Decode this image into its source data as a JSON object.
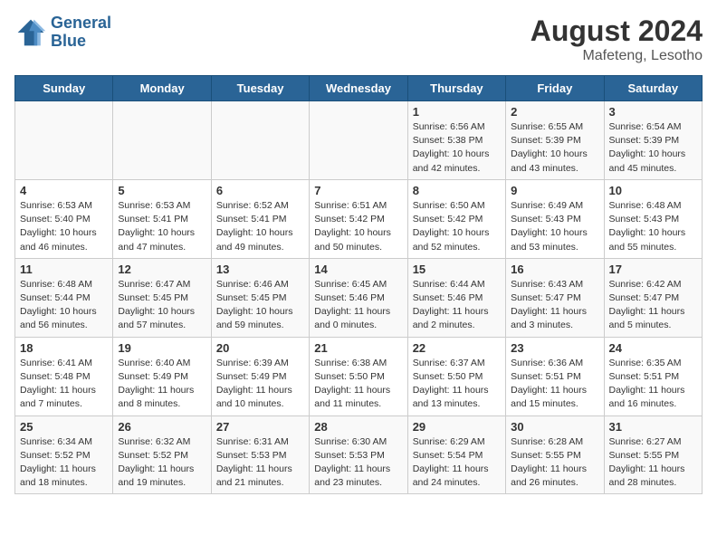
{
  "header": {
    "logo_line1": "General",
    "logo_line2": "Blue",
    "month_year": "August 2024",
    "location": "Mafeteng, Lesotho"
  },
  "weekdays": [
    "Sunday",
    "Monday",
    "Tuesday",
    "Wednesday",
    "Thursday",
    "Friday",
    "Saturday"
  ],
  "weeks": [
    [
      {
        "day": "",
        "info": ""
      },
      {
        "day": "",
        "info": ""
      },
      {
        "day": "",
        "info": ""
      },
      {
        "day": "",
        "info": ""
      },
      {
        "day": "1",
        "info": "Sunrise: 6:56 AM\nSunset: 5:38 PM\nDaylight: 10 hours\nand 42 minutes."
      },
      {
        "day": "2",
        "info": "Sunrise: 6:55 AM\nSunset: 5:39 PM\nDaylight: 10 hours\nand 43 minutes."
      },
      {
        "day": "3",
        "info": "Sunrise: 6:54 AM\nSunset: 5:39 PM\nDaylight: 10 hours\nand 45 minutes."
      }
    ],
    [
      {
        "day": "4",
        "info": "Sunrise: 6:53 AM\nSunset: 5:40 PM\nDaylight: 10 hours\nand 46 minutes."
      },
      {
        "day": "5",
        "info": "Sunrise: 6:53 AM\nSunset: 5:41 PM\nDaylight: 10 hours\nand 47 minutes."
      },
      {
        "day": "6",
        "info": "Sunrise: 6:52 AM\nSunset: 5:41 PM\nDaylight: 10 hours\nand 49 minutes."
      },
      {
        "day": "7",
        "info": "Sunrise: 6:51 AM\nSunset: 5:42 PM\nDaylight: 10 hours\nand 50 minutes."
      },
      {
        "day": "8",
        "info": "Sunrise: 6:50 AM\nSunset: 5:42 PM\nDaylight: 10 hours\nand 52 minutes."
      },
      {
        "day": "9",
        "info": "Sunrise: 6:49 AM\nSunset: 5:43 PM\nDaylight: 10 hours\nand 53 minutes."
      },
      {
        "day": "10",
        "info": "Sunrise: 6:48 AM\nSunset: 5:43 PM\nDaylight: 10 hours\nand 55 minutes."
      }
    ],
    [
      {
        "day": "11",
        "info": "Sunrise: 6:48 AM\nSunset: 5:44 PM\nDaylight: 10 hours\nand 56 minutes."
      },
      {
        "day": "12",
        "info": "Sunrise: 6:47 AM\nSunset: 5:45 PM\nDaylight: 10 hours\nand 57 minutes."
      },
      {
        "day": "13",
        "info": "Sunrise: 6:46 AM\nSunset: 5:45 PM\nDaylight: 10 hours\nand 59 minutes."
      },
      {
        "day": "14",
        "info": "Sunrise: 6:45 AM\nSunset: 5:46 PM\nDaylight: 11 hours\nand 0 minutes."
      },
      {
        "day": "15",
        "info": "Sunrise: 6:44 AM\nSunset: 5:46 PM\nDaylight: 11 hours\nand 2 minutes."
      },
      {
        "day": "16",
        "info": "Sunrise: 6:43 AM\nSunset: 5:47 PM\nDaylight: 11 hours\nand 3 minutes."
      },
      {
        "day": "17",
        "info": "Sunrise: 6:42 AM\nSunset: 5:47 PM\nDaylight: 11 hours\nand 5 minutes."
      }
    ],
    [
      {
        "day": "18",
        "info": "Sunrise: 6:41 AM\nSunset: 5:48 PM\nDaylight: 11 hours\nand 7 minutes."
      },
      {
        "day": "19",
        "info": "Sunrise: 6:40 AM\nSunset: 5:49 PM\nDaylight: 11 hours\nand 8 minutes."
      },
      {
        "day": "20",
        "info": "Sunrise: 6:39 AM\nSunset: 5:49 PM\nDaylight: 11 hours\nand 10 minutes."
      },
      {
        "day": "21",
        "info": "Sunrise: 6:38 AM\nSunset: 5:50 PM\nDaylight: 11 hours\nand 11 minutes."
      },
      {
        "day": "22",
        "info": "Sunrise: 6:37 AM\nSunset: 5:50 PM\nDaylight: 11 hours\nand 13 minutes."
      },
      {
        "day": "23",
        "info": "Sunrise: 6:36 AM\nSunset: 5:51 PM\nDaylight: 11 hours\nand 15 minutes."
      },
      {
        "day": "24",
        "info": "Sunrise: 6:35 AM\nSunset: 5:51 PM\nDaylight: 11 hours\nand 16 minutes."
      }
    ],
    [
      {
        "day": "25",
        "info": "Sunrise: 6:34 AM\nSunset: 5:52 PM\nDaylight: 11 hours\nand 18 minutes."
      },
      {
        "day": "26",
        "info": "Sunrise: 6:32 AM\nSunset: 5:52 PM\nDaylight: 11 hours\nand 19 minutes."
      },
      {
        "day": "27",
        "info": "Sunrise: 6:31 AM\nSunset: 5:53 PM\nDaylight: 11 hours\nand 21 minutes."
      },
      {
        "day": "28",
        "info": "Sunrise: 6:30 AM\nSunset: 5:53 PM\nDaylight: 11 hours\nand 23 minutes."
      },
      {
        "day": "29",
        "info": "Sunrise: 6:29 AM\nSunset: 5:54 PM\nDaylight: 11 hours\nand 24 minutes."
      },
      {
        "day": "30",
        "info": "Sunrise: 6:28 AM\nSunset: 5:55 PM\nDaylight: 11 hours\nand 26 minutes."
      },
      {
        "day": "31",
        "info": "Sunrise: 6:27 AM\nSunset: 5:55 PM\nDaylight: 11 hours\nand 28 minutes."
      }
    ]
  ]
}
